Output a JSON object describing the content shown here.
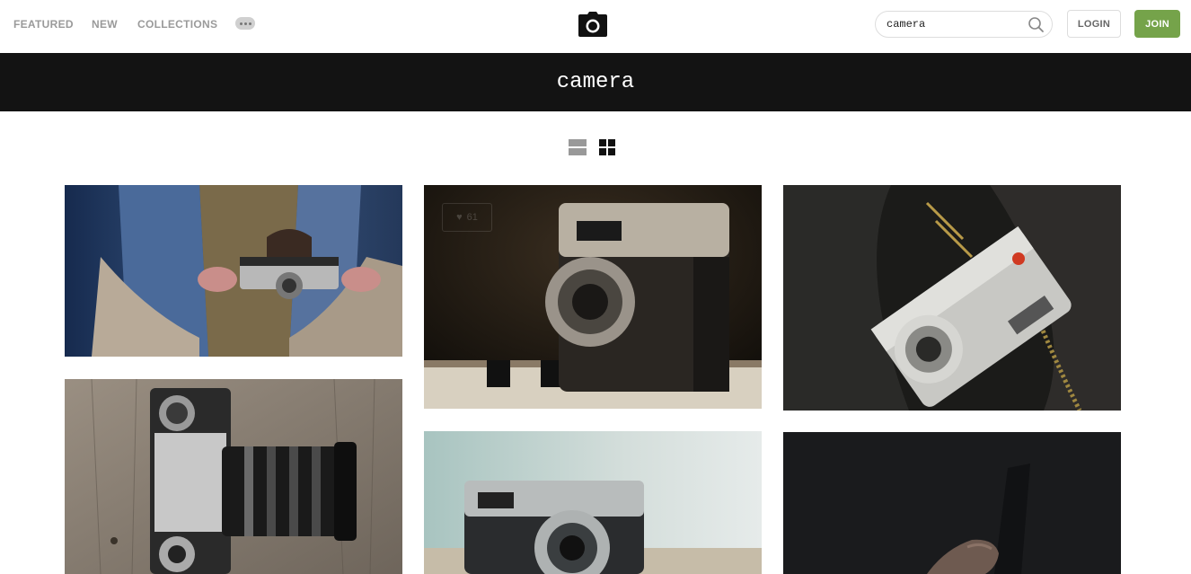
{
  "nav": {
    "links": [
      "FEATURED",
      "NEW",
      "COLLECTIONS"
    ],
    "more_icon": "ellipsis-icon",
    "logo_icon": "camera-icon"
  },
  "search": {
    "value": "camera",
    "icon": "search-icon"
  },
  "auth": {
    "login_label": "LOGIN",
    "join_label": "JOIN"
  },
  "banner": {
    "title": "camera"
  },
  "view_toggle": {
    "list_icon": "list-view-icon",
    "grid_icon": "grid-view-icon",
    "active": "grid"
  },
  "photos": [
    {
      "alt": "person holding silver camera in denim jacket"
    },
    {
      "alt": "vintage rangefinder camera on piano keys",
      "likes": "61"
    },
    {
      "alt": "silver fujifilm camera in hand with dark jacket"
    },
    {
      "alt": "silver SLR camera with zoom lens on wooden floor"
    },
    {
      "alt": "vintage camera on blurred light background"
    },
    {
      "alt": "hand holding dark object on black background"
    }
  ],
  "colors": {
    "accent": "#75a34a",
    "banner_bg": "#131313",
    "nav_text": "#9a9a9a"
  }
}
